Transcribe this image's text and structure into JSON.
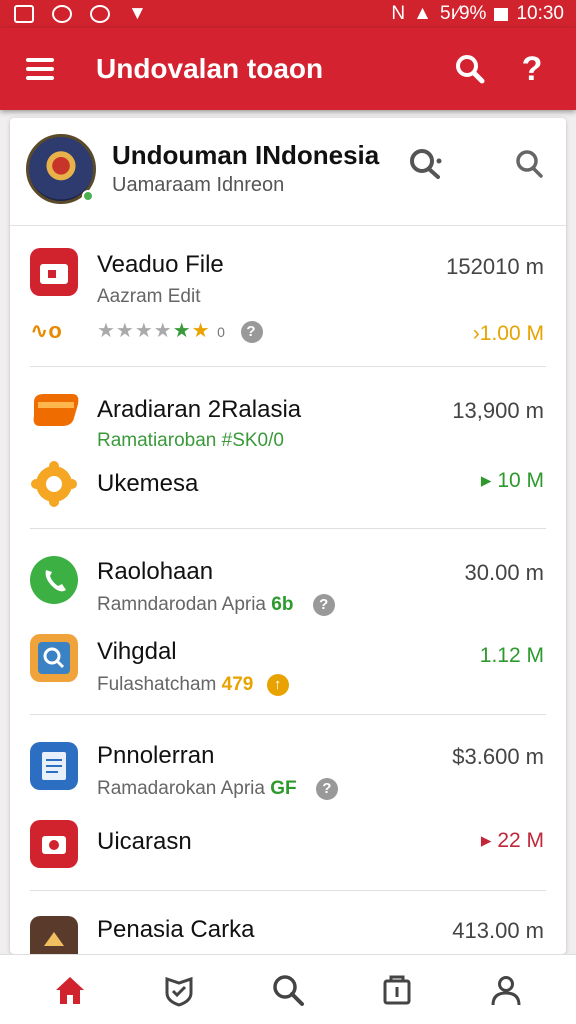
{
  "status_bar": {
    "battery": "5ı⁄9%",
    "time": "10:30"
  },
  "app_bar": {
    "title": "Undovalan toaon"
  },
  "header": {
    "title": "Undouman INdonesia",
    "subtitle": "Uamaraam Idnreon"
  },
  "apps": [
    {
      "name": "Veaduo File",
      "sub": "Aazram Edit",
      "size": "152010 m",
      "rating_value": "0",
      "download": "1.00 M",
      "dl_color": "#e8a300"
    },
    {
      "name": "Aradiaran 2Ralasia",
      "sub": "Ramatiaroban #SK0/0",
      "size": "13,900 m",
      "download": null
    },
    {
      "name": "Ukemesa",
      "download": "10 M",
      "dl_color": "#2e9a2e"
    },
    {
      "name": "Raolohaan",
      "sub": "Ramndarodan Apria",
      "sub_accent": "6b",
      "size": "30.00 m"
    },
    {
      "name": "Vihgdal",
      "sub": "Fulashatcham",
      "sub_accent": "479",
      "download": "1.12 M",
      "dl_color": "#2e9a2e"
    },
    {
      "name": "Pnnolerran",
      "sub": "Ramadarokan Apria",
      "sub_accent": "GF",
      "size": "$3.600 m"
    },
    {
      "name": "Uicarasn",
      "download": "22 M",
      "dl_color": "#c0283a"
    },
    {
      "name": "Penasia Carka",
      "size": "413.00 m"
    }
  ],
  "colors": {
    "primary": "#d42230",
    "accent_orange": "#e8a300",
    "accent_green": "#2e9a2e"
  },
  "icons": {
    "menu": "menu-icon",
    "search": "search-icon",
    "help": "help-icon",
    "nav": [
      "home-icon",
      "shield-icon",
      "search-icon",
      "store-icon",
      "profile-icon"
    ]
  }
}
